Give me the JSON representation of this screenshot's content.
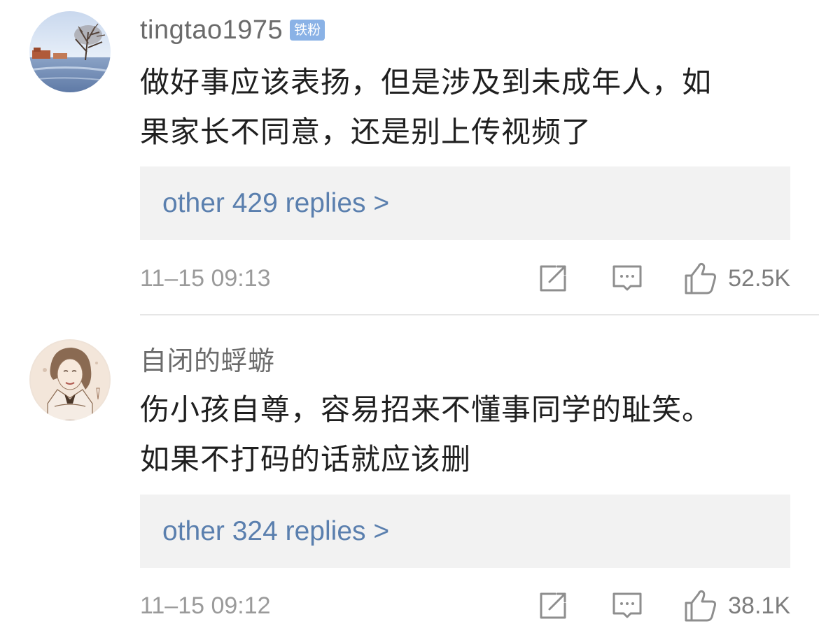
{
  "comments": [
    {
      "username": "tingtao1975",
      "badge": "铁粉",
      "text_line1": "做好事应该表扬，但是涉及到未成年人，如",
      "text_line2": "果家长不同意，还是别上传视频了",
      "replies_label": "other 429 replies >",
      "timestamp": "11–15 09:13",
      "likes": "52.5K",
      "avatar_icon": "winter-snow-landscape-avatar"
    },
    {
      "username": "自闭的蜉蝣",
      "text_line1": "伤小孩自尊，容易招来不懂事同学的耻笑。",
      "text_line2": "如果不打码的话就应该删",
      "replies_label": "other 324 replies >",
      "timestamp": "11–15 09:12",
      "likes": "38.1K",
      "avatar_icon": "sketched-girl-portrait-avatar"
    }
  ],
  "colors": {
    "badge_bg": "#8ab2e6",
    "link": "#5a7fae",
    "reply_box_bg": "#f2f2f2",
    "text_primary": "#1f1f1f",
    "text_secondary": "#9a9a9a"
  },
  "icons": [
    "share-icon",
    "comment-icon",
    "like-icon"
  ]
}
